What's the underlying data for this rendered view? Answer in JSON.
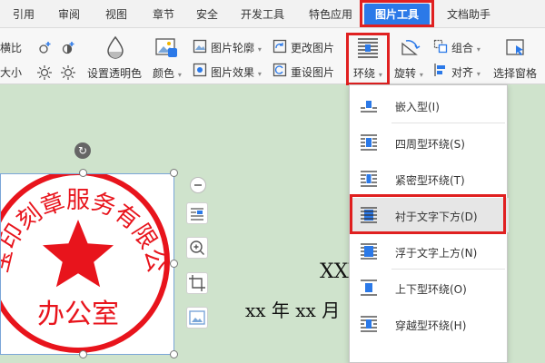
{
  "menubar": {
    "tabs": [
      {
        "label": "引用",
        "active": false
      },
      {
        "label": "审阅",
        "active": false
      },
      {
        "label": "视图",
        "active": false
      },
      {
        "label": "章节",
        "active": false
      },
      {
        "label": "安全",
        "active": false
      },
      {
        "label": "开发工具",
        "active": false
      },
      {
        "label": "特色应用",
        "active": false
      },
      {
        "label": "图片工具",
        "active": true
      },
      {
        "label": "文档助手",
        "active": false
      }
    ]
  },
  "ribbon": {
    "partial_top": "横比",
    "partial_bottom": "大小",
    "set_transparent": "设置透明色",
    "color": "颜色",
    "picture_outline": "图片轮廓",
    "picture_effect": "图片效果",
    "change_picture": "更改图片",
    "reset_picture": "重设图片",
    "wrap": "环绕",
    "rotate": "旋转",
    "group": "组合",
    "align": "对齐",
    "selection_pane": "选择窗格"
  },
  "stamp": {
    "ring_text": "广州宝印刻章服务有限公司版",
    "center_text": "办公室",
    "color": "#e8141c"
  },
  "document": {
    "line1": "XXX",
    "line2": "xx 年 xx 月"
  },
  "wrap_menu": {
    "items": [
      {
        "label": "嵌入型(I)",
        "selected": false
      },
      {
        "label": "四周型环绕(S)",
        "selected": false
      },
      {
        "label": "紧密型环绕(T)",
        "selected": false
      },
      {
        "label": "衬于文字下方(D)",
        "selected": true
      },
      {
        "label": "浮于文字上方(N)",
        "selected": false
      },
      {
        "label": "上下型环绕(O)",
        "selected": false
      },
      {
        "label": "穿越型环绕(H)",
        "selected": false
      }
    ]
  },
  "colors": {
    "accent": "#2b79e8",
    "highlight": "#e02020",
    "doc_background": "#cfe3cc"
  }
}
